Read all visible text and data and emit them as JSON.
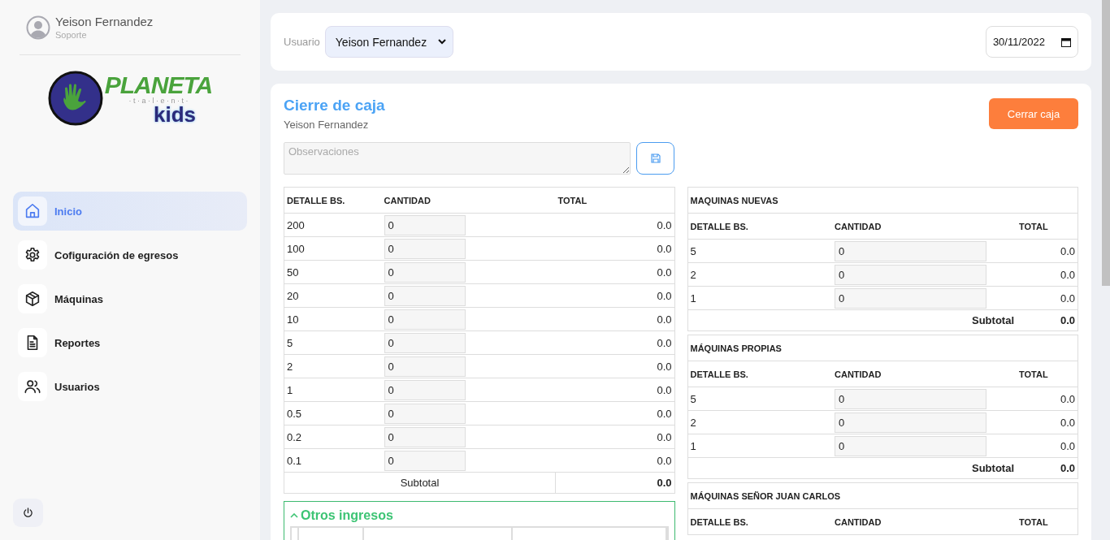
{
  "sidebar": {
    "user": {
      "name": "Yeison Fernandez",
      "role": "Soporte"
    },
    "logo": {
      "word": "PLANETA",
      "tagline": "· t · a · l · e · n · t ·",
      "sub": "kids"
    },
    "items": [
      {
        "label": "Inicio",
        "selected": true
      },
      {
        "label": "Cofiguración de egresos",
        "selected": false
      },
      {
        "label": "Máquinas",
        "selected": false
      },
      {
        "label": "Reportes",
        "selected": false
      },
      {
        "label": "Usuarios",
        "selected": false
      }
    ]
  },
  "toolbar": {
    "label": "Usuario",
    "user_select": "Yeison Fernandez",
    "date": "30/11/2022"
  },
  "card": {
    "title": "Cierre de caja",
    "subtitle": "Yeison Fernandez",
    "close_button": "Cerrar caja",
    "notes": {
      "placeholder": "Observaciones"
    },
    "bills": {
      "columns": [
        "DETALLE BS.",
        "CANTIDAD",
        "TOTAL"
      ],
      "rows": [
        {
          "detail": "200",
          "qty": "0",
          "total": "0.0"
        },
        {
          "detail": "100",
          "qty": "0",
          "total": "0.0"
        },
        {
          "detail": "50",
          "qty": "0",
          "total": "0.0"
        },
        {
          "detail": "20",
          "qty": "0",
          "total": "0.0"
        },
        {
          "detail": "10",
          "qty": "0",
          "total": "0.0"
        },
        {
          "detail": "5",
          "qty": "0",
          "total": "0.0"
        },
        {
          "detail": "2",
          "qty": "0",
          "total": "0.0"
        },
        {
          "detail": "1",
          "qty": "0",
          "total": "0.0"
        },
        {
          "detail": "0.5",
          "qty": "0",
          "total": "0.0"
        },
        {
          "detail": "0.2",
          "qty": "0",
          "total": "0.0"
        },
        {
          "detail": "0.1",
          "qty": "0",
          "total": "0.0"
        }
      ],
      "subtotal_label": "Subtotal",
      "subtotal": "0.0"
    },
    "otros_ingresos": {
      "title": "Otros ingresos",
      "expanded": true
    },
    "machines": [
      {
        "title": "MAQUINAS NUEVAS",
        "columns": [
          "DETALLE BS.",
          "CANTIDAD",
          "TOTAL"
        ],
        "rows": [
          {
            "detail": "5",
            "qty": "0",
            "total": "0.0"
          },
          {
            "detail": "2",
            "qty": "0",
            "total": "0.0"
          },
          {
            "detail": "1",
            "qty": "0",
            "total": "0.0"
          }
        ],
        "subtotal_label": "Subtotal",
        "subtotal": "0.0"
      },
      {
        "title": "MÁQUINAS PROPIAS",
        "columns": [
          "DETALLE BS.",
          "CANTIDAD",
          "TOTAL"
        ],
        "rows": [
          {
            "detail": "5",
            "qty": "0",
            "total": "0.0"
          },
          {
            "detail": "2",
            "qty": "0",
            "total": "0.0"
          },
          {
            "detail": "1",
            "qty": "0",
            "total": "0.0"
          }
        ],
        "subtotal_label": "Subtotal",
        "subtotal": "0.0"
      },
      {
        "title": "MÁQUINAS SEÑOR JUAN CARLOS",
        "columns": [
          "DETALLE BS.",
          "CANTIDAD",
          "TOTAL"
        ]
      }
    ]
  }
}
